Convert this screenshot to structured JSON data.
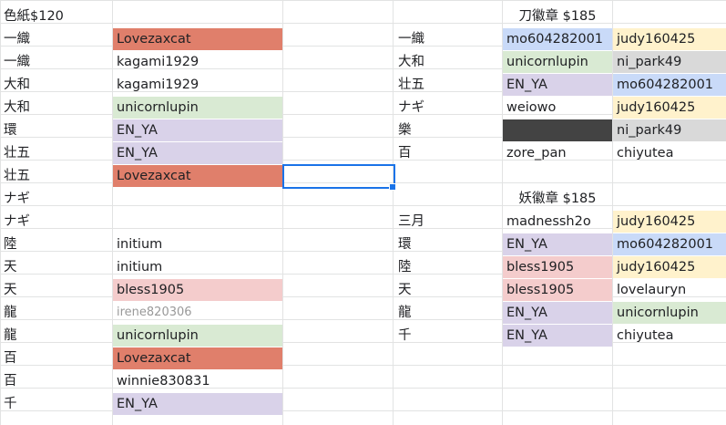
{
  "colors": {
    "salmon": "#e07f6b",
    "lavender": "#d9d2e9",
    "green": "#d9ead3",
    "blue": "#c9daf8",
    "yellow": "#fff2cc",
    "pink": "#f4cccc",
    "gray": "#d9d9d9",
    "dark": "#434343",
    "selection": "#1a73e8"
  },
  "left_title": "色紙$120",
  "left_rows": [
    {
      "name": "一織",
      "user": "Lovezaxcat",
      "color": "#e07f6b"
    },
    {
      "name": "一織",
      "user": "kagami1929",
      "color": ""
    },
    {
      "name": "大和",
      "user": "kagami1929",
      "color": ""
    },
    {
      "name": "大和",
      "user": "unicornlupin",
      "color": "#d9ead3"
    },
    {
      "name": "環",
      "user": "EN_YA",
      "color": "#d9d2e9"
    },
    {
      "name": "壮五",
      "user": "EN_YA",
      "color": "#d9d2e9"
    },
    {
      "name": "壮五",
      "user": "Lovezaxcat",
      "color": "#e07f6b"
    },
    {
      "name": "ナギ",
      "user": "",
      "color": ""
    },
    {
      "name": "ナギ",
      "user": "",
      "color": ""
    },
    {
      "name": "陸",
      "user": "initium",
      "color": ""
    },
    {
      "name": "天",
      "user": "initium",
      "color": ""
    },
    {
      "name": "天",
      "user": "bless1905",
      "color": "#f4cccc"
    },
    {
      "name": "龍",
      "user": "irene820306",
      "color": "",
      "muted": true
    },
    {
      "name": "龍",
      "user": "unicornlupin",
      "color": "#d9ead3"
    },
    {
      "name": "百",
      "user": "Lovezaxcat",
      "color": "#e07f6b"
    },
    {
      "name": "百",
      "user": "winnie830831",
      "color": ""
    },
    {
      "name": "千",
      "user": "EN_YA",
      "color": "#d9d2e9"
    }
  ],
  "sword_title": "刀徽章 $185",
  "sword_rows": [
    {
      "name": "一織",
      "u1": "mo604282001",
      "c1": "#c9daf8",
      "u2": "judy160425",
      "c2": "#fff2cc"
    },
    {
      "name": "大和",
      "u1": "unicornlupin",
      "c1": "#d9ead3",
      "u2": "ni_park49",
      "c2": "#d9d9d9"
    },
    {
      "name": "壮五",
      "u1": "EN_YA",
      "c1": "#d9d2e9",
      "u2": "mo604282001",
      "c2": "#c9daf8"
    },
    {
      "name": "ナギ",
      "u1": "weiowo",
      "c1": "",
      "u2": "judy160425",
      "c2": "#fff2cc"
    },
    {
      "name": "樂",
      "u1": "",
      "c1": "#434343",
      "u2": "ni_park49",
      "c2": "#d9d9d9"
    },
    {
      "name": "百",
      "u1": "zore_pan",
      "c1": "",
      "u2": "chiyutea",
      "c2": ""
    }
  ],
  "demon_title": "妖徽章 $185",
  "demon_rows": [
    {
      "name": "三月",
      "u1": "madnessh2o",
      "c1": "",
      "u2": "judy160425",
      "c2": "#fff2cc"
    },
    {
      "name": "環",
      "u1": "EN_YA",
      "c1": "#d9d2e9",
      "u2": "mo604282001",
      "c2": "#c9daf8"
    },
    {
      "name": "陸",
      "u1": "bless1905",
      "c1": "#f4cccc",
      "u2": "judy160425",
      "c2": "#fff2cc"
    },
    {
      "name": "天",
      "u1": "bless1905",
      "c1": "#f4cccc",
      "u2": "lovelauryn",
      "c2": ""
    },
    {
      "name": "龍",
      "u1": "EN_YA",
      "c1": "#d9d2e9",
      "u2": "unicornlupin",
      "c2": "#d9ead3"
    },
    {
      "name": "千",
      "u1": "EN_YA",
      "c1": "#d9d2e9",
      "u2": "chiyutea",
      "c2": ""
    }
  ]
}
